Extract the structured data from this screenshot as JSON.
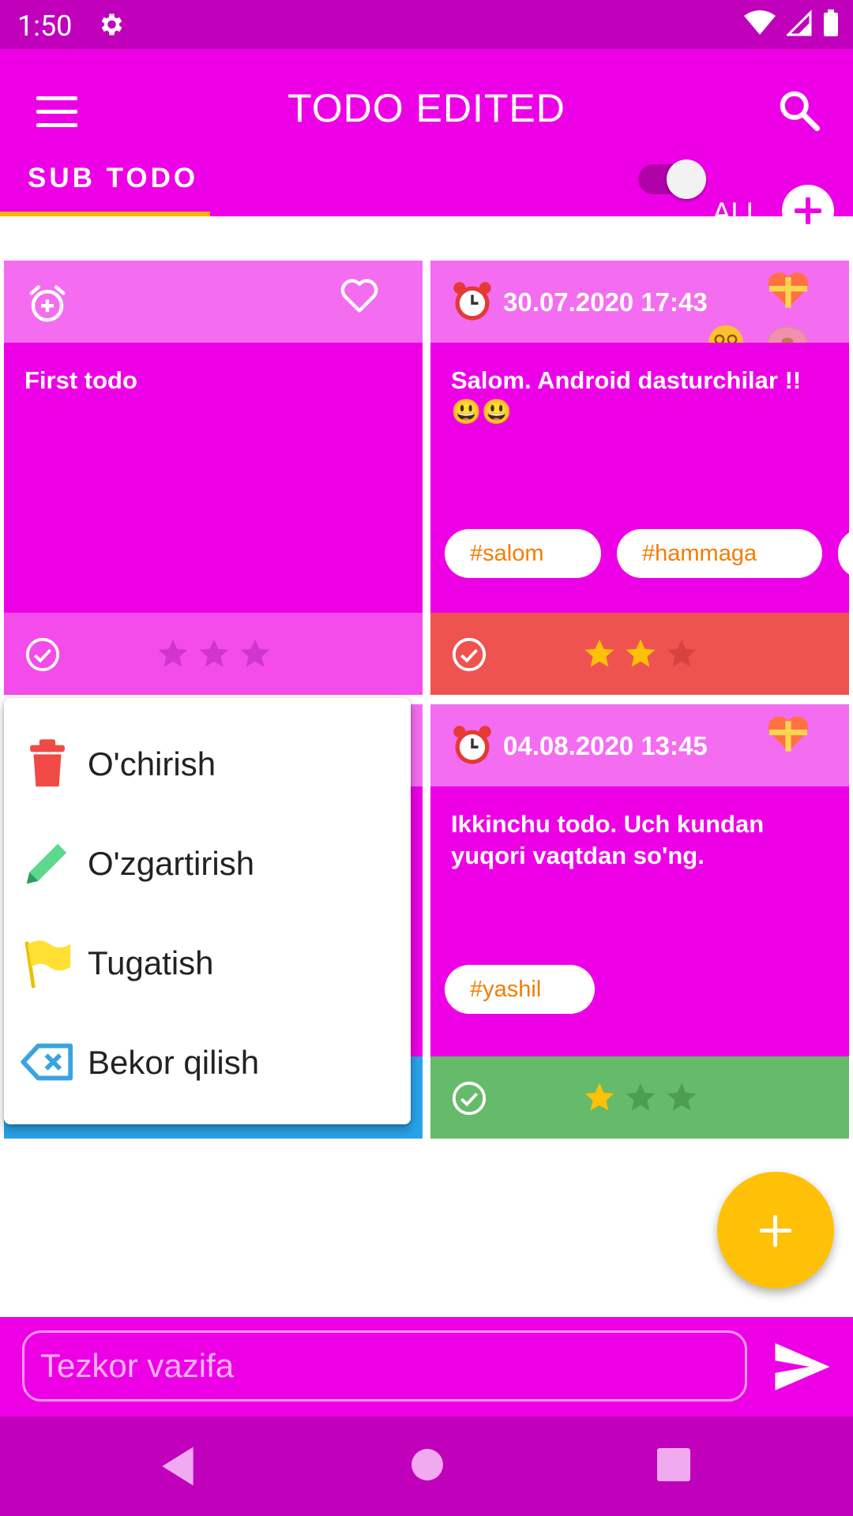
{
  "status_bar": {
    "time": "1:50"
  },
  "toolbar": {
    "title": "TODO EDITED"
  },
  "tabs": {
    "sub_todo": "SUB TODO",
    "toggle_label": "ALL"
  },
  "cards": [
    {
      "id": "card1",
      "text": "First todo",
      "stars": 0,
      "footer_color": "#f44ceb"
    },
    {
      "id": "card2",
      "date": "30.07.2020 17:43",
      "text": "Salom. Android dasturchilar !! 😃😃",
      "tags": [
        "#salom",
        "#hammaga"
      ],
      "stars": 2,
      "footer_color": "#ef5350"
    },
    {
      "id": "card4",
      "date": "04.08.2020 13:45",
      "text": "Ikkinchu todo. Uch kundan yuqori vaqtdan so'ng.",
      "tags": [
        "#yashil"
      ],
      "stars": 1,
      "footer_color": "#66bb6a"
    }
  ],
  "popup_menu": {
    "items": [
      {
        "label": "O'chirish",
        "icon": "trash-icon"
      },
      {
        "label": "O'zgartirish",
        "icon": "pencil-icon"
      },
      {
        "label": "Tugatish",
        "icon": "flag-icon"
      },
      {
        "label": "Bekor qilish",
        "icon": "backspace-icon"
      }
    ]
  },
  "input": {
    "placeholder": "Tezkor vazifa"
  },
  "colors": {
    "primary": "#ee00e6",
    "primary_dark": "#c000bb",
    "card_head": "#f46df0",
    "accent": "#ffc107",
    "tag_text": "#f57c00"
  }
}
